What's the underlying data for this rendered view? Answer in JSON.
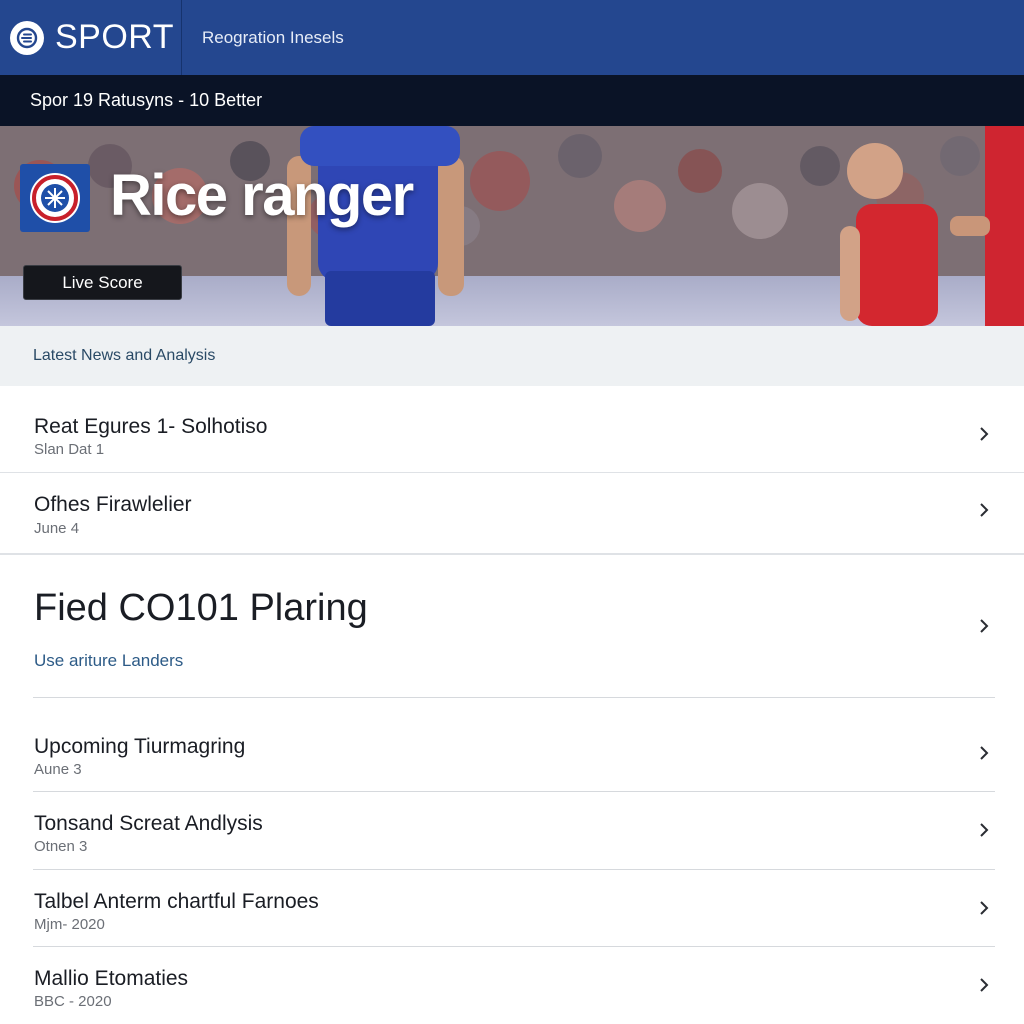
{
  "header": {
    "brand": "SPORT",
    "nav_link": "Reogration Inesels"
  },
  "ticker": {
    "text": "Spor 19 Ratusyns - 10 Better"
  },
  "hero": {
    "title": "Rice ranger",
    "live_button": "Live Score"
  },
  "section": {
    "title": "Latest News and Analysis"
  },
  "news": [
    {
      "title": "Reat Egures 1- Solhotiso",
      "subtitle": "Slan Dat 1"
    },
    {
      "title": "Ofhes Firawlelier",
      "subtitle": "June 4"
    }
  ],
  "feature": {
    "title": "Fied CO101 Plaring",
    "link": "Use ariture Landers"
  },
  "more_news": [
    {
      "title": "Upcoming Tiurmagring",
      "subtitle": "Aune 3"
    },
    {
      "title": "Tonsand Screat Andlysis",
      "subtitle": "Otnen 3"
    },
    {
      "title": "Talbel Anterm chartful Farnoes",
      "subtitle": "Mjm- 2020"
    },
    {
      "title": "Mallio Etomaties",
      "subtitle": "BBC - 2020"
    }
  ],
  "colors": {
    "header_bg": "#24478f",
    "ticker_bg": "#0a1326",
    "section_bg": "#eef1f3",
    "link": "#2d5b87"
  },
  "icons": {
    "brand": "sport-logo-icon",
    "chevron": "chevron-right-icon",
    "club_badge": "club-crest-icon"
  }
}
